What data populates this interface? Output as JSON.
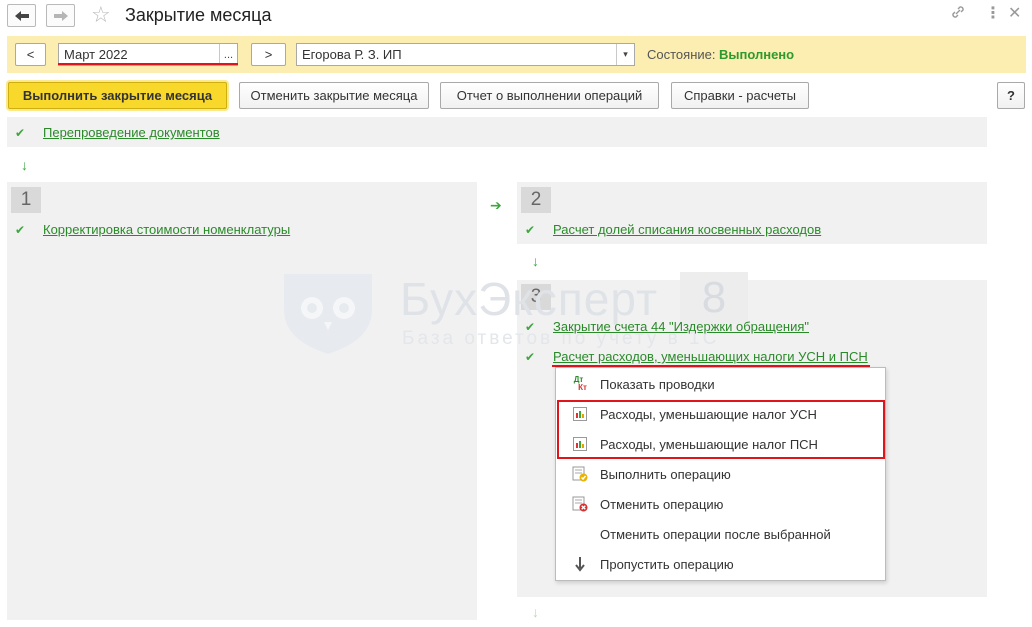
{
  "header": {
    "title": "Закрытие месяца"
  },
  "period_bar": {
    "prev_label": "<",
    "next_label": ">",
    "period_value": "Март 2022",
    "period_button": "...",
    "org_value": "Егорова Р. З. ИП",
    "status_label": "Состояние:",
    "status_value": "Выполнено"
  },
  "toolbar": {
    "execute": "Выполнить закрытие месяца",
    "cancel": "Отменить закрытие месяца",
    "report": "Отчет о выполнении операций",
    "refs": "Справки - расчеты",
    "help": "?"
  },
  "steps": {
    "pre": {
      "link": "Перепроведение документов"
    },
    "s1": {
      "num": "1",
      "links": [
        "Корректировка стоимости номенклатуры"
      ]
    },
    "s2": {
      "num": "2",
      "links": [
        "Расчет долей списания косвенных расходов"
      ]
    },
    "s3": {
      "num": "3",
      "links": [
        "Закрытие счета 44 \"Издержки обращения\"",
        "Расчет расходов, уменьшающих налоги УСН и ПСН"
      ]
    }
  },
  "watermark": {
    "title": "БухЭксперт",
    "badge": "8",
    "subtitle": "База ответов по учету в 1С"
  },
  "context_menu": {
    "items": [
      {
        "label": "Показать проводки",
        "icon": "dt-kt-icon"
      },
      {
        "label": "Расходы, уменьшающие налог УСН",
        "icon": "report-icon"
      },
      {
        "label": "Расходы, уменьшающие налог ПСН",
        "icon": "report-icon"
      },
      {
        "label": "Выполнить операцию",
        "icon": "execute-op-icon"
      },
      {
        "label": "Отменить операцию",
        "icon": "cancel-op-icon"
      },
      {
        "label": "Отменить операции после выбранной",
        "icon": ""
      },
      {
        "label": "Пропустить операцию",
        "icon": "skip-arrow-icon"
      }
    ],
    "dt_kt_text": {
      "top": "Дт",
      "bottom": "Кт"
    }
  },
  "colors": {
    "accent_yellow": "#f7d82b",
    "status_green": "#2d9a2d",
    "link_green": "#2a8a2a",
    "highlight_red": "#e0141b"
  }
}
